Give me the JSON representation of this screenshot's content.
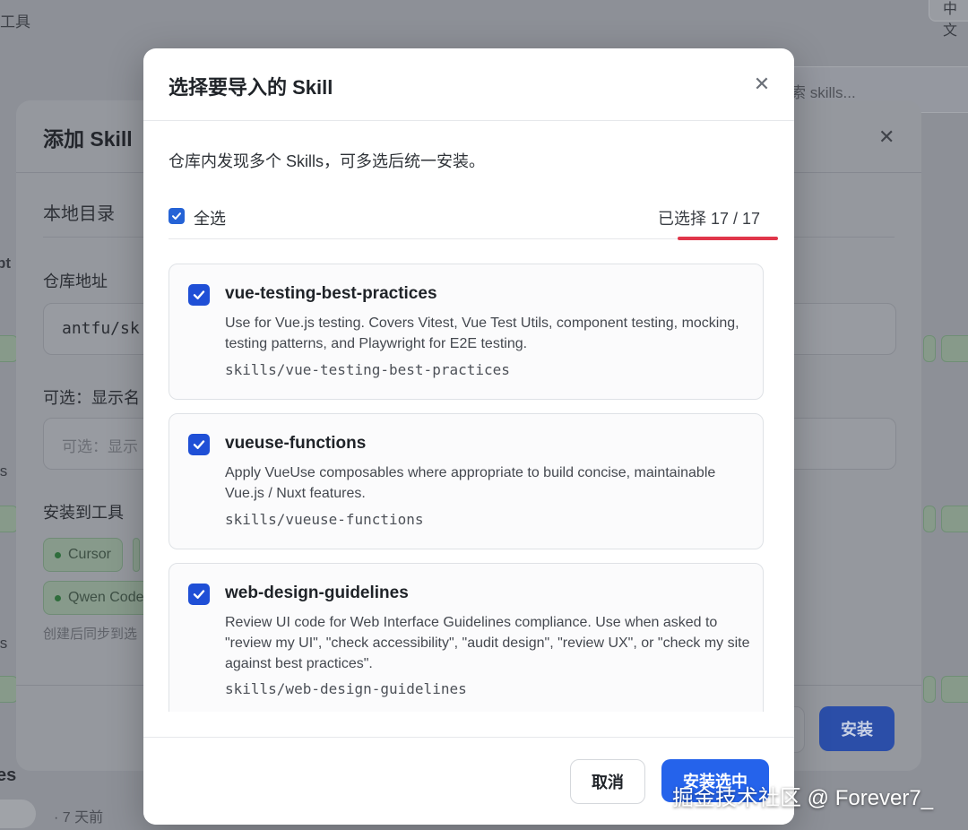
{
  "background": {
    "top_left_text": "工具",
    "lang_button": "中文",
    "search_placeholder": "索 skills...",
    "sidebar_fragments": [
      "pt",
      "ls",
      "ls",
      "es"
    ],
    "bottom_meta": "· 7 天前"
  },
  "add_dialog": {
    "title": "添加 Skill",
    "tab_local": "本地目录",
    "repo_label": "仓库地址",
    "repo_value": "antfu/sk",
    "display_name_label": "可选：显示名",
    "display_name_placeholder": "可选：显示",
    "install_to_label": "安装到工具",
    "tools": [
      "Cursor",
      "Qwen Code"
    ],
    "hint": "创建后同步到选",
    "install_button": "安装"
  },
  "modal": {
    "title": "选择要导入的 Skill",
    "description": "仓库内发现多个 Skills，可多选后统一安装。",
    "select_all_label": "全选",
    "selected_count": "已选择 17 / 17",
    "skills": [
      {
        "name": "vue-testing-best-practices",
        "description": "Use for Vue.js testing. Covers Vitest, Vue Test Utils, component testing, mocking, testing patterns, and Playwright for E2E testing.",
        "path": "skills/vue-testing-best-practices",
        "checked": true
      },
      {
        "name": "vueuse-functions",
        "description": "Apply VueUse composables where appropriate to build concise, maintainable Vue.js / Nuxt features.",
        "path": "skills/vueuse-functions",
        "checked": true
      },
      {
        "name": "web-design-guidelines",
        "description": "Review UI code for Web Interface Guidelines compliance. Use when asked to \"review my UI\", \"check accessibility\", \"audit design\", \"review UX\", or \"check my site against best practices\".",
        "path": "skills/web-design-guidelines",
        "checked": true
      }
    ],
    "cancel_button": "取消",
    "install_selected_button": "安装选中"
  },
  "watermark": "掘金技术社区 @ Forever7_",
  "colors": {
    "accent": "#2563eb",
    "checkbox": "#1f4fd6",
    "highlight_underline": "#e0364a"
  }
}
